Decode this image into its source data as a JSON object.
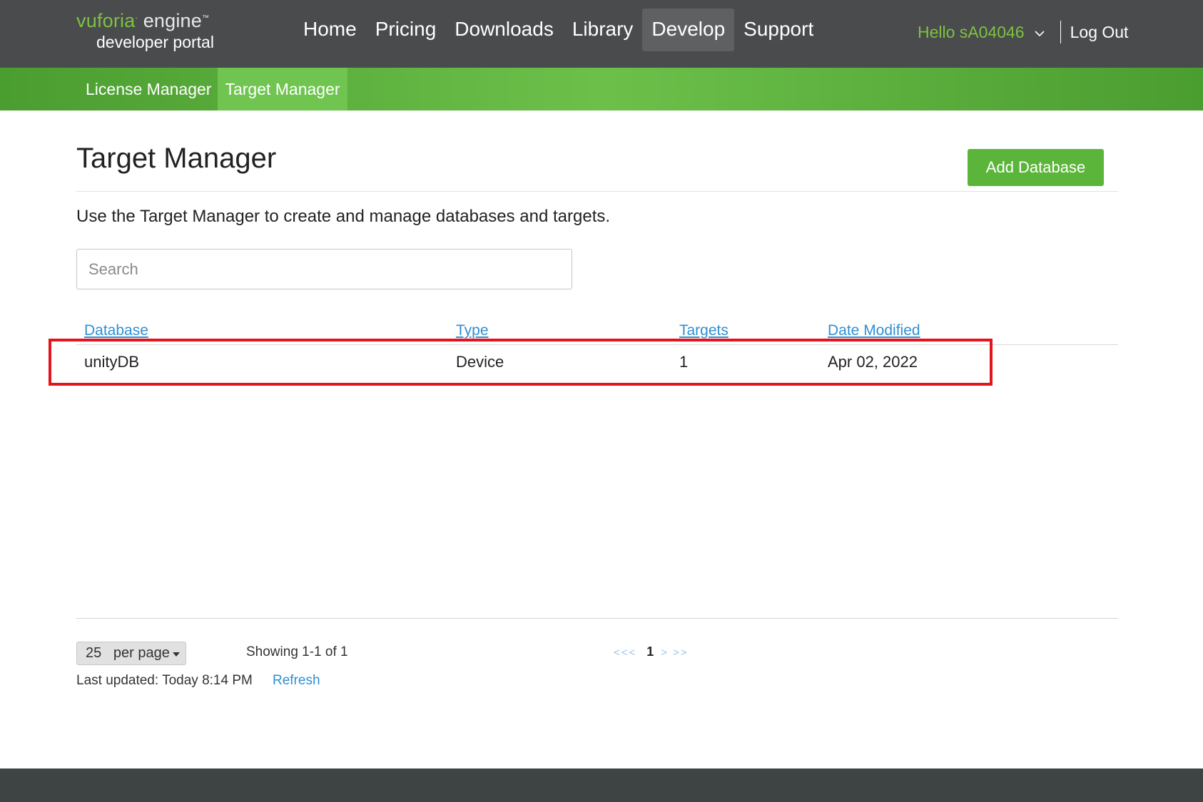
{
  "header": {
    "logo": {
      "brand": "vuforia",
      "product": "engine",
      "subtitle": "developer portal"
    },
    "nav": [
      {
        "label": "Home",
        "active": false
      },
      {
        "label": "Pricing",
        "active": false
      },
      {
        "label": "Downloads",
        "active": false
      },
      {
        "label": "Library",
        "active": false
      },
      {
        "label": "Develop",
        "active": true
      },
      {
        "label": "Support",
        "active": false
      }
    ],
    "greeting": "Hello sA04046",
    "logout_label": "Log Out"
  },
  "subnav": [
    {
      "label": "License Manager",
      "active": false
    },
    {
      "label": "Target Manager",
      "active": true
    }
  ],
  "page": {
    "title": "Target Manager",
    "add_button_label": "Add Database",
    "description": "Use the Target Manager to create and manage databases and targets.",
    "search": {
      "value": "",
      "placeholder": "Search"
    }
  },
  "table": {
    "columns": [
      "Database",
      "Type",
      "Targets",
      "Date Modified"
    ],
    "rows": [
      {
        "database": "unityDB",
        "type": "Device",
        "targets": "1",
        "date_modified": "Apr 02, 2022"
      }
    ]
  },
  "pagination": {
    "per_page_value": "25",
    "per_page_label": "per page",
    "showing": "Showing 1-1 of 1",
    "first": "<<<",
    "current_page": "1",
    "next": ">",
    "last": ">>",
    "last_updated": "Last updated: Today 8:14 PM",
    "refresh_label": "Refresh"
  },
  "colors": {
    "topbar": "#4a4b4d",
    "accent_green": "#5cb53b",
    "link_blue": "#2f8fd1",
    "highlight_red": "#e3141d",
    "footer": "#3e4444"
  }
}
